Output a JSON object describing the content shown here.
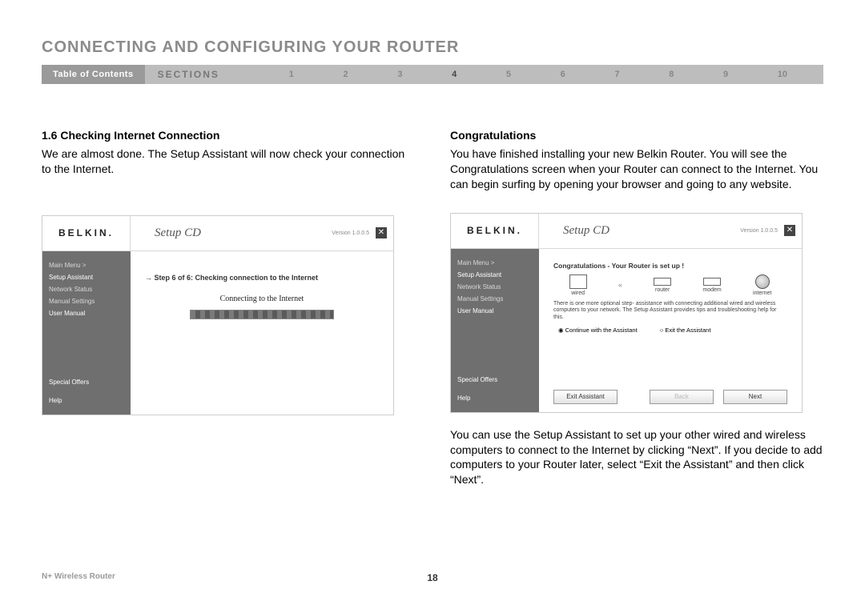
{
  "page_title": "CONNECTING AND CONFIGURING YOUR ROUTER",
  "nav": {
    "toc": "Table of Contents",
    "sections_label": "SECTIONS",
    "links": [
      "1",
      "2",
      "3",
      "4",
      "5",
      "6",
      "7",
      "8",
      "9",
      "10"
    ],
    "active_index": 3
  },
  "left": {
    "heading": "1.6 Checking Internet Connection",
    "body": "We are almost done. The Setup Assistant will now check your connection to the Internet."
  },
  "right": {
    "heading": "Congratulations",
    "body1": "You have finished installing your new Belkin Router. You will see the Congratulations screen when your Router can connect to the Internet. You can begin surfing by opening your browser and going to any website.",
    "body2": "You can use the Setup Assistant to set up your other wired and wireless computers to connect to the Internet by clicking “Next”. If you decide to add computers to your Router later, select “Exit the Assistant” and then click “Next”."
  },
  "ss": {
    "logo": "BELKIN.",
    "title": "Setup CD",
    "version": "Version 1.0.0.5",
    "sidebar": {
      "items": [
        "Main Menu  >",
        "Setup Assistant",
        "Network Status",
        "Manual Settings",
        "User Manual"
      ],
      "bottom": [
        "Special Offers",
        "Help"
      ]
    },
    "left_panel": {
      "step_text": "Step 6 of 6: Checking connection to the Internet",
      "connecting": "Connecting to the Internet"
    },
    "right_panel": {
      "congrats": "Congratulations - Your Router is set up !",
      "diagram_labels": [
        "wired",
        "router",
        "modem",
        "internet"
      ],
      "desc": "There is one more optional step- assistance with connecting additional wired and wireless computers to your network. The Setup Assistant provides tips and troubleshooting help for this.",
      "radio_continue": "Continue with the Assistant",
      "radio_exit": "Exit the Assistant",
      "btn_exit": "Exit Assistant",
      "btn_back": "Back",
      "btn_next": "Next"
    }
  },
  "footer": {
    "product": "N+ Wireless Router",
    "page": "18"
  }
}
